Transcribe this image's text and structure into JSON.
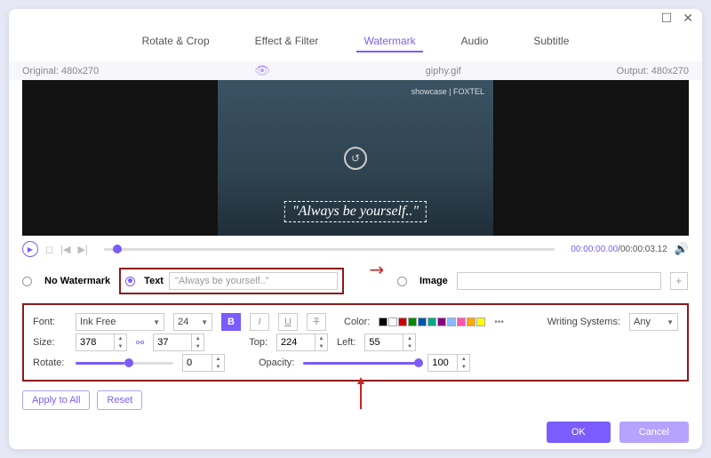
{
  "titlebar": {
    "maximize": "☐",
    "close": "✕"
  },
  "tabs": {
    "rotate": "Rotate & Crop",
    "effect": "Effect & Filter",
    "watermark": "Watermark",
    "audio": "Audio",
    "subtitle": "Subtitle"
  },
  "infobar": {
    "original": "Original: 480x270",
    "filename": "giphy.gif",
    "output": "Output: 480x270"
  },
  "preview": {
    "brand": "showcase | FOXTEL",
    "text": "\"Always be yourself..\""
  },
  "player": {
    "current": "00:00:00.00",
    "total": "/00:00:03.12"
  },
  "wm": {
    "none": "No Watermark",
    "text_label": "Text",
    "text_value": "\"Always be yourself..\"",
    "image_label": "Image"
  },
  "settings": {
    "font_label": "Font:",
    "font_value": "Ink Free",
    "font_size": "24",
    "color_label": "Color:",
    "writing_label": "Writing Systems:",
    "writing_value": "Any",
    "size_label": "Size:",
    "size_w": "378",
    "size_h": "37",
    "top_label": "Top:",
    "top_value": "224",
    "left_label": "Left:",
    "left_value": "55",
    "rotate_label": "Rotate:",
    "rotate_value": "0",
    "opacity_label": "Opacity:",
    "opacity_value": "100"
  },
  "swatches": [
    "#000",
    "#fff",
    "#c00",
    "#080",
    "#05a",
    "#0a8",
    "#808",
    "#8bf",
    "#f5a",
    "#fa0",
    "#ff0"
  ],
  "buttons": {
    "apply": "Apply to All",
    "reset": "Reset",
    "ok": "OK",
    "cancel": "Cancel"
  }
}
